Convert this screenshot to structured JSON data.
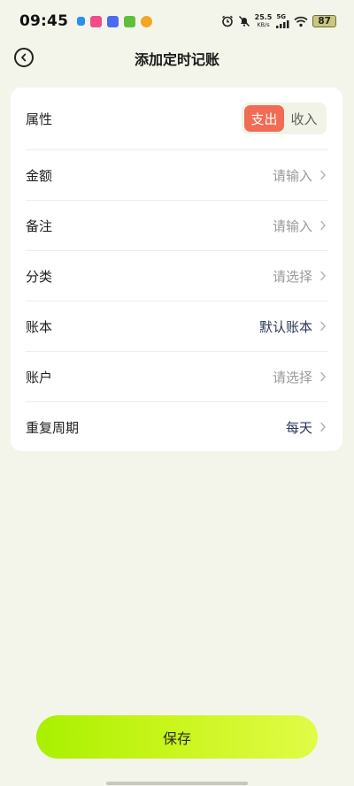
{
  "status_bar": {
    "time": "09:45",
    "net_speed_value": "25.5",
    "net_speed_unit": "KB/s",
    "network_type": "5G",
    "battery": "87"
  },
  "header": {
    "title": "添加定时记账",
    "back_icon": "chevron-left-circle-icon"
  },
  "form": {
    "attribute": {
      "label": "属性",
      "options": [
        "支出",
        "收入"
      ],
      "selected": "支出"
    },
    "rows": [
      {
        "key": "amount",
        "label": "金额",
        "value": "请输入",
        "is_placeholder": true
      },
      {
        "key": "note",
        "label": "备注",
        "value": "请输入",
        "is_placeholder": true
      },
      {
        "key": "category",
        "label": "分类",
        "value": "请选择",
        "is_placeholder": true
      },
      {
        "key": "ledger",
        "label": "账本",
        "value": "默认账本",
        "is_placeholder": false
      },
      {
        "key": "account",
        "label": "账户",
        "value": "请选择",
        "is_placeholder": true
      },
      {
        "key": "repeat",
        "label": "重复周期",
        "value": "每天",
        "is_placeholder": false
      }
    ]
  },
  "footer": {
    "save_label": "保存"
  },
  "colors": {
    "background": "#f4f5ea",
    "accent_expense": "#f26b55",
    "save_gradient_start": "#a8f000",
    "save_gradient_end": "#e2fb47",
    "filled_value": "#2b3557",
    "placeholder": "#9a9a9a"
  }
}
